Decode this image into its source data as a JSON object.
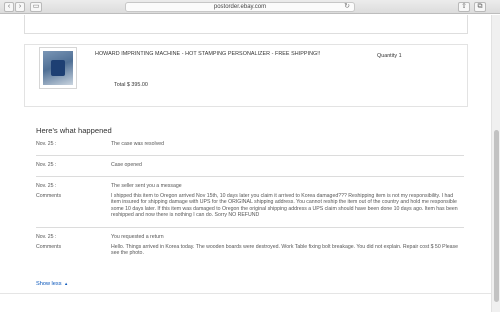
{
  "browser": {
    "url": "postorder.ebay.com",
    "back_label": "‹",
    "forward_label": "›",
    "sidebar_label": "▭",
    "share_label": "⇧",
    "tabs_label": "⧉",
    "reload_label": "↻"
  },
  "item": {
    "title": "HOWARD IMPRINTING MACHINE - HOT STAMPING PERSONALIZER - FREE SHIPPING!!",
    "quantity": "Quantity 1",
    "total": "Total $ 395.00",
    "image_icon": "product-photo"
  },
  "history": {
    "heading": "Here's what happened",
    "entries": [
      {
        "label": "Nov. 25 :",
        "text": "The case was resolved"
      },
      {
        "label": "Nov. 25 :",
        "text": "Case opened"
      },
      {
        "label": "Nov. 25 :",
        "text": "The seller sent you a message"
      },
      {
        "label": "Comments",
        "text": "I shipped this item to Oregon arrived Nov 15th, 10 days later you claim it arrived to Korea damaged??? Reshipping item is not my responsibility. I had item insured for shipping damage with UPS for the ORIGINAL shipping address. You cannot reship the item out of the country and hold me responsible some 10 days later. If this item was damaged to Oregon the original shipping address a UPS claim should have been done 10 days ago. Item has been reshipped and now there is nothing I can do. Sorry NO REFUND"
      },
      {
        "label": "Nov. 25 :",
        "text": "You requested a return"
      },
      {
        "label": "Comments",
        "text": "Hello. Things arrived in Korea today. The wooden boards were destroyed. Work Table fixing bolt breakage. You did not explain. Repair cost $ 50 Please see the photo."
      }
    ]
  },
  "show_less": "Show less",
  "colors": {
    "link": "#0654ba",
    "text": "#555555",
    "divider": "#dcdcdc"
  }
}
